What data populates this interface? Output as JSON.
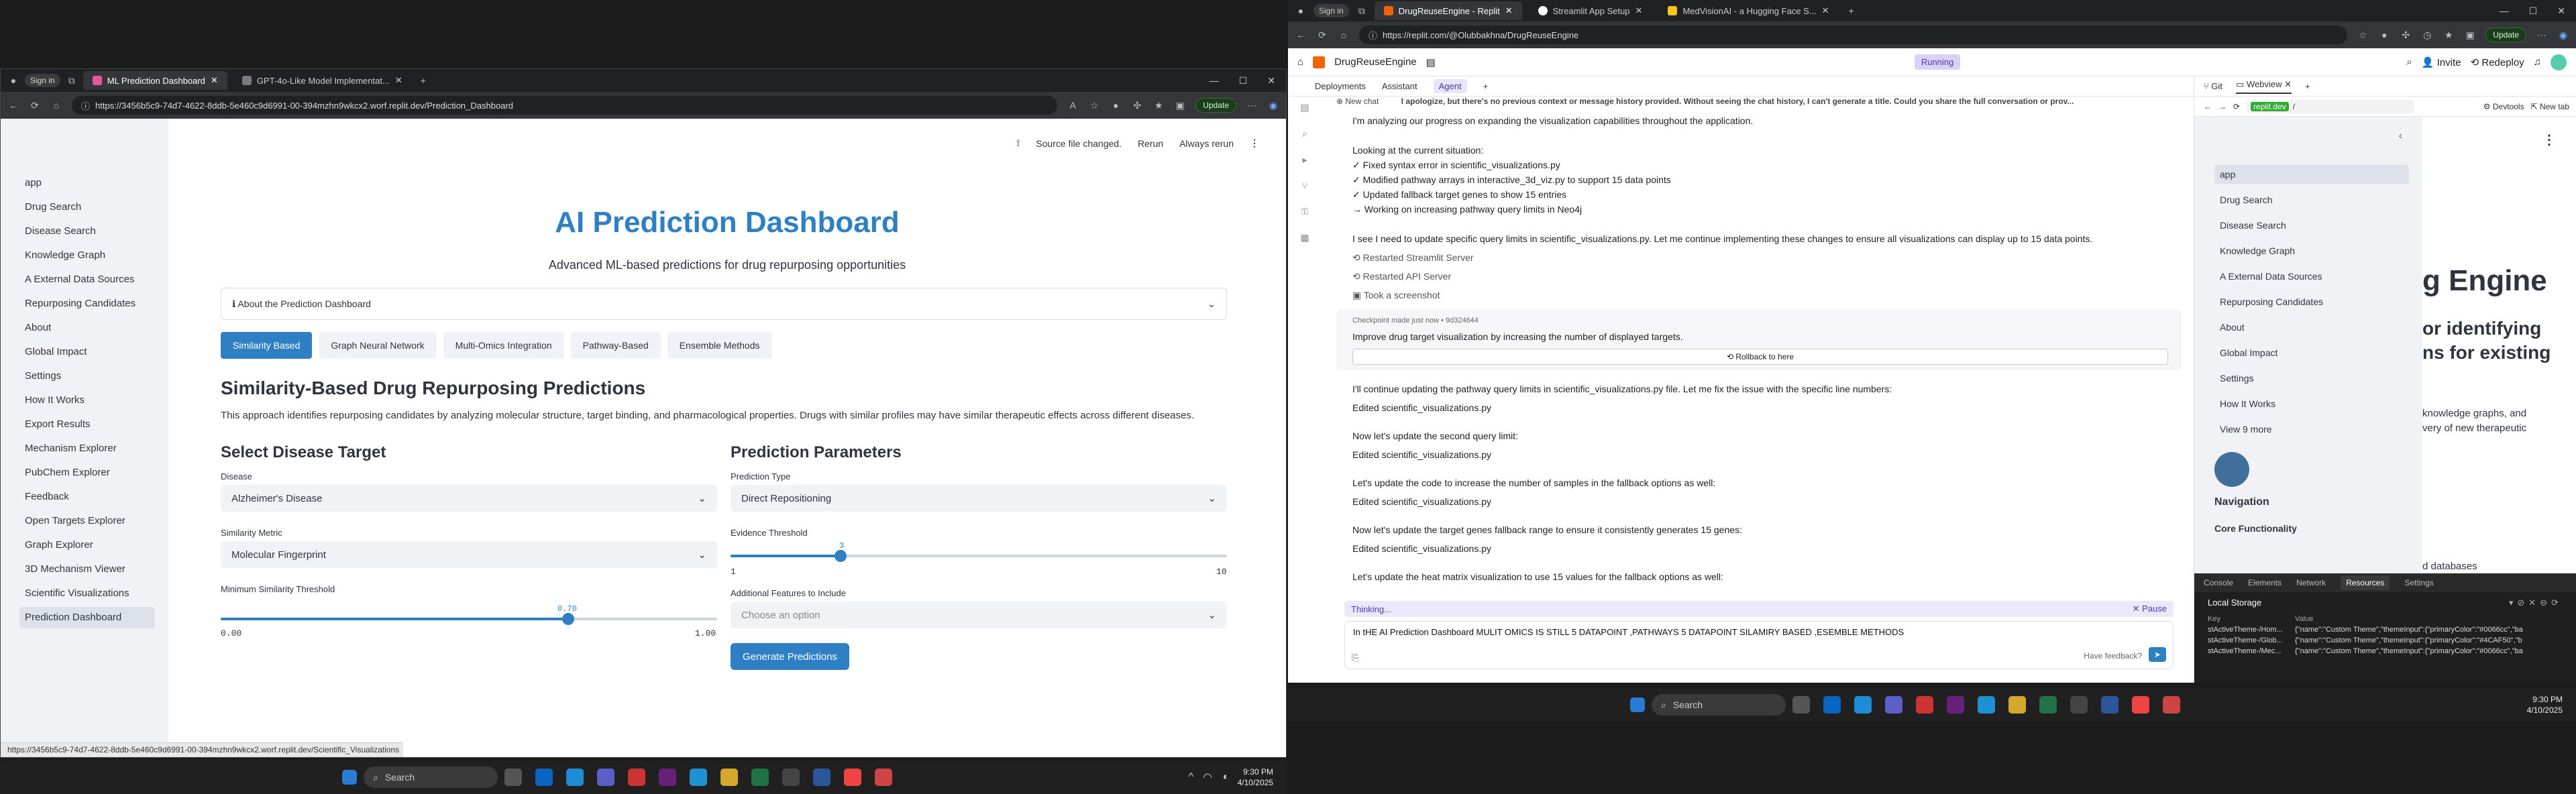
{
  "left": {
    "tabs": [
      {
        "label": "ML Prediction Dashboard",
        "color": "#e8569b"
      },
      {
        "label": "GPT-4o-Like Model Implementat...",
        "color": "#7a7a7a"
      }
    ],
    "url": "https://3456b5c9-74d7-4622-8ddb-5e460c9d6991-00-394mzhn9wkcx2.worf.replit.dev/Prediction_Dashboard",
    "update_label": "Update",
    "user": "Sign in",
    "sidebar": [
      "app",
      "Drug Search",
      "Disease Search",
      "Knowledge Graph",
      "A External Data Sources",
      "Repurposing Candidates",
      "About",
      "Global Impact",
      "Settings",
      "How It Works",
      "Export Results",
      "Mechanism Explorer",
      "PubChem Explorer",
      "Feedback",
      "Open Targets Explorer",
      "Graph Explorer",
      "3D Mechanism Viewer",
      "Scientific Visualizations",
      "Prediction Dashboard"
    ],
    "topbar": {
      "changed": "Source file changed.",
      "rerun": "Rerun",
      "always": "Always rerun"
    },
    "title": "AI Prediction Dashboard",
    "subtitle": "Advanced ML-based predictions for drug repurposing opportunities",
    "expander": "ℹ About the Prediction Dashboard",
    "method_tabs": [
      "Similarity Based",
      "Graph Neural Network",
      "Multi-Omics Integration",
      "Pathway-Based",
      "Ensemble Methods"
    ],
    "section_title": "Similarity-Based Drug Repurposing Predictions",
    "description": "This approach identifies repurposing candidates by analyzing molecular structure, target binding, and pharmacological properties. Drugs with similar profiles may have similar therapeutic effects across different diseases.",
    "select_target": "Select Disease Target",
    "disease_label": "Disease",
    "disease_value": "Alzheimer's Disease",
    "metric_label": "Similarity Metric",
    "metric_value": "Molecular Fingerprint",
    "threshold_label": "Minimum Similarity Threshold",
    "threshold_value": "0.70",
    "threshold_fraction": 0.7,
    "threshold_min": "0.00",
    "threshold_max": "1.00",
    "params_title": "Prediction Parameters",
    "ptype_label": "Prediction Type",
    "ptype_value": "Direct Repositioning",
    "evidence_label": "Evidence Threshold",
    "evidence_value": "3",
    "evidence_fraction": 0.222,
    "evidence_min": "1",
    "evidence_max": "10",
    "features_label": "Additional Features to Include",
    "features_placeholder": "Choose an option",
    "generate": "Generate Predictions",
    "status_url": "https://3456b5c9-74d7-4622-8ddb-5e460c9d6991-00-394mzhn9wkcx2.worf.replit.dev/Scientific_Visualizations"
  },
  "taskbar_left": {
    "search": "Search",
    "time": "9:30 PM",
    "date": "4/10/2025"
  },
  "right": {
    "tabs": [
      {
        "label": "DrugReuseEngine - Replit",
        "color": "#f26207"
      },
      {
        "label": "Streamlit App Setup",
        "color": "#ffffff"
      },
      {
        "label": "MedVisionAI - a Hugging Face S...",
        "color": "#f5c518"
      }
    ],
    "url": "https://replit.com/@Olubbakhna/DrugReuseEngine",
    "update_label": "Update",
    "user": "Sign in",
    "project": "DrugReuseEngine",
    "status": "Running",
    "invite": "Invite",
    "redeploy": "Redeploy",
    "pane_tabs": [
      "Deployments",
      "Assistant",
      "Agent"
    ],
    "new_chat": "New chat",
    "chat_header": "I apologize, but there's no previous context or message history provided. Without seeing the chat history, I can't generate a title. Could you share the full conversation or prov...",
    "chat_lines": [
      "I'm analyzing our progress on expanding the visualization capabilities throughout the application.",
      "Looking at the current situation:",
      "✓ Fixed syntax error in scientific_visualizations.py",
      "✓ Modified pathway arrays in interactive_3d_viz.py to support 15 data points",
      "✓ Updated fallback target genes to show 15 entries",
      "→ Working on increasing pathway query limits in Neo4j",
      "I see I need to update specific query limits in scientific_visualizations.py. Let me continue implementing these changes to ensure all visualizations can display up to 15 data points."
    ],
    "actions": [
      "Restarted Streamlit Server",
      "Restarted API Server",
      "Took a screenshot"
    ],
    "checkpoint": "Checkpoint made just now • 9d324644",
    "checkpoint_msg": "Improve drug target visualization by increasing the number of displayed targets.",
    "rollback": "Rollback to here",
    "followups": [
      "I'll continue updating the pathway query limits in scientific_visualizations.py file. Let me fix the issue with the specific line numbers:",
      "Edited scientific_visualizations.py",
      "Now let's update the second query limit:",
      "Edited scientific_visualizations.py",
      "Let's update the code to increase the number of samples in the fallback options as well:",
      "Edited scientific_visualizations.py",
      "Now let's update the target genes fallback range to ensure it consistently generates 15 genes:",
      "Edited scientific_visualizations.py",
      "Let's update the heat matrix visualization to use 15 values for the fallback options as well:"
    ],
    "thinking": "Thinking...",
    "pause": "Pause",
    "input": "In tHE AI Prediction Dashboard MULIT OMICS IS STILL 5 DATAPOINT ,PATHWAYS 5 DATAPOINT SILAMIRY BASED ,ESEMBLE METHODS",
    "feedback": "Have feedback?",
    "wv_tabs": [
      "Git",
      "Webview"
    ],
    "wv_url": "replit.dev",
    "wv_path": "/",
    "devtools_label": "Devtools",
    "newtab": "New tab",
    "wv_nav": [
      "app",
      "Drug Search",
      "Disease Search",
      "Knowledge Graph",
      "A External Data Sources",
      "Repurposing Candidates",
      "About",
      "Global Impact",
      "Settings",
      "How It Works",
      "View 9 more"
    ],
    "wv_title_frag": "g Engine",
    "wv_sub1": "or identifying",
    "wv_sub2": "ns for existing",
    "wv_text1": "knowledge graphs, and",
    "wv_text2": "very of new therapeutic",
    "wv_navhead": "Navigation",
    "wv_core": "Core Functionality",
    "wv_dbs": "d databases",
    "dev_tabs": [
      "Console",
      "Elements",
      "Network",
      "Resources",
      "Settings"
    ],
    "local_storage": "Local Storage",
    "key_h": "Key",
    "val_h": "Value",
    "rows": [
      [
        "stActiveTheme-/Hom...",
        "{\"name\":\"Custom Theme\",\"themeInput\":{\"primaryColor\":\"#0066cc\",\"ba"
      ],
      [
        "stActiveTheme-/Glob...",
        "{\"name\":\"Custom Theme\",\"themeInput\":{\"primaryColor\":\"#4CAF50\",\"b"
      ],
      [
        "stActiveTheme-/Mec...",
        "{\"name\":\"Custom Theme\",\"themeInput\":{\"primaryColor\":\"#0066cc\",\"ba"
      ]
    ]
  },
  "taskbar_right": {
    "search": "Search",
    "time": "9:30 PM",
    "date": "4/10/2025"
  }
}
